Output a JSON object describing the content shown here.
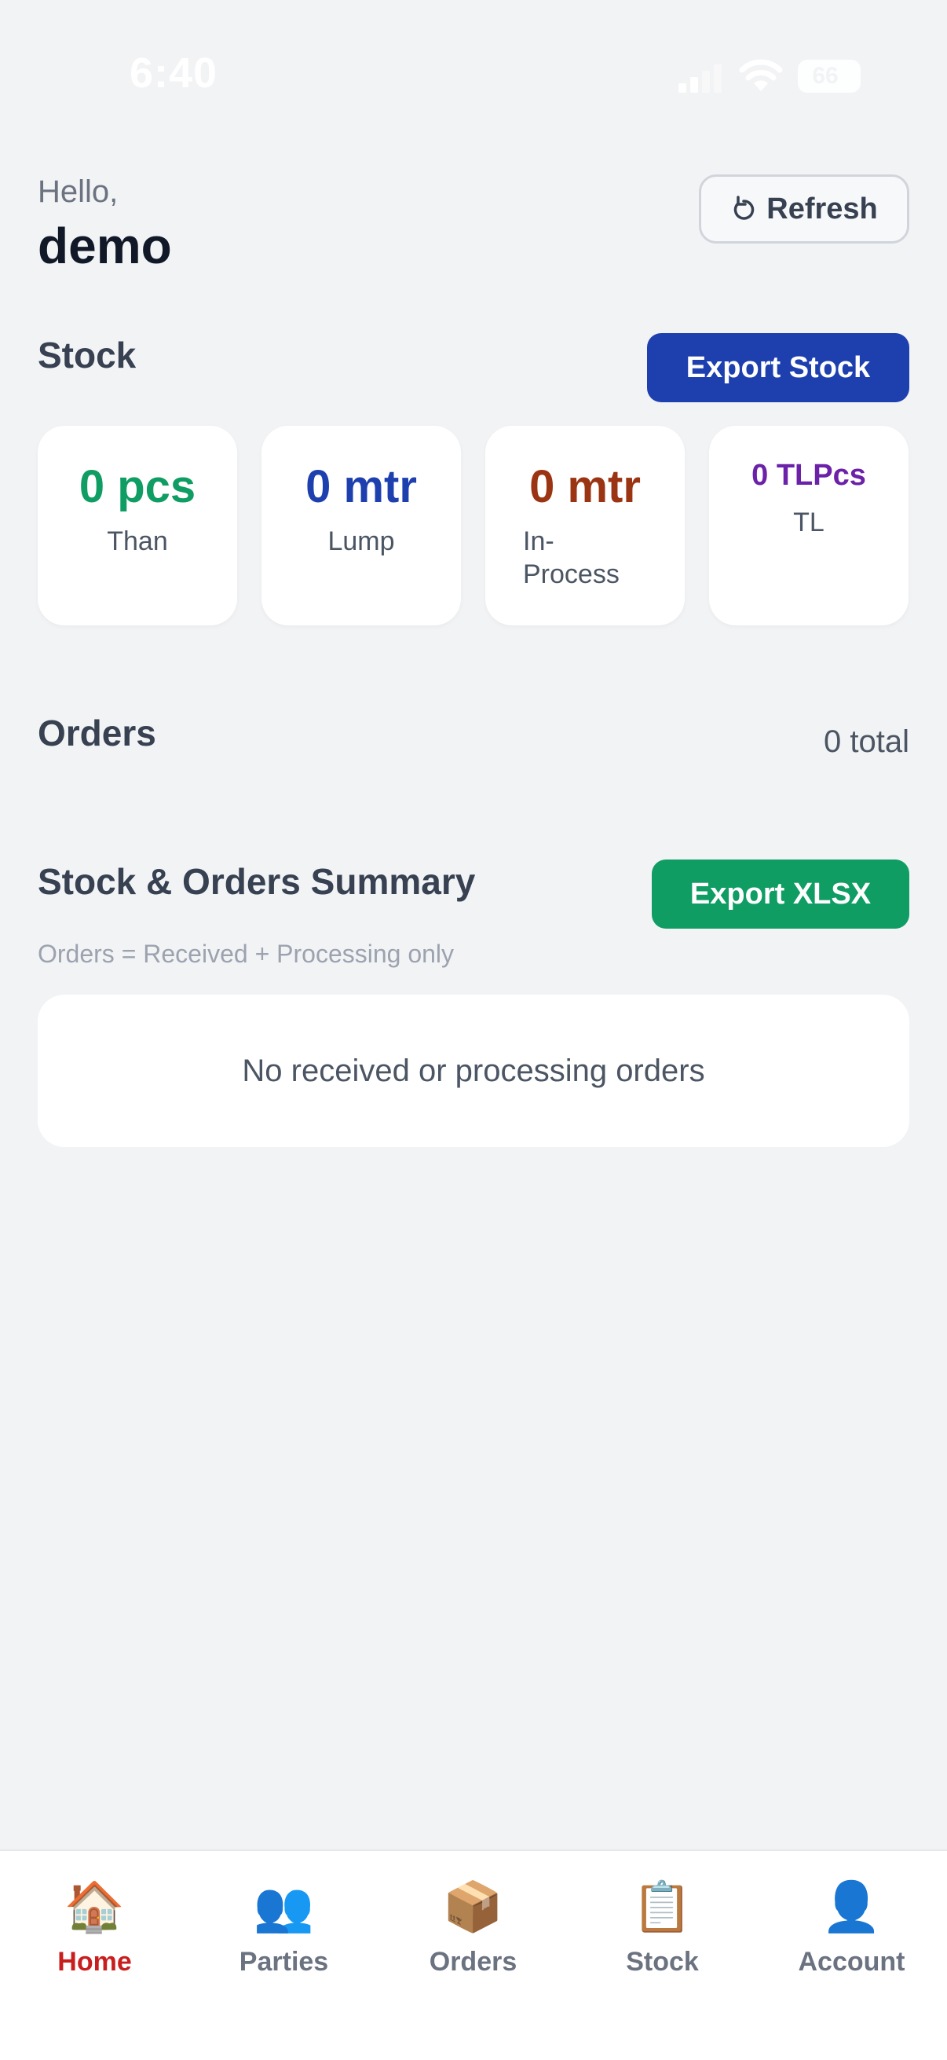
{
  "status_bar": {
    "time": "6:40",
    "battery": "66"
  },
  "header": {
    "greeting": "Hello,",
    "username": "demo",
    "refresh_label": "Refresh"
  },
  "stock": {
    "title": "Stock",
    "export_label": "Export Stock",
    "cards": [
      {
        "value": "0 pcs",
        "label": "Than",
        "color": "#0f9d64"
      },
      {
        "value": "0 mtr",
        "label": "Lump",
        "color": "#1e40af"
      },
      {
        "value": "0 mtr",
        "label": "In-Process",
        "color": "#9a3412"
      },
      {
        "value": "0 TLPcs",
        "label": "TL",
        "color": "#6b21a8"
      }
    ]
  },
  "orders": {
    "title": "Orders",
    "total": "0 total"
  },
  "summary": {
    "title": "Stock & Orders Summary",
    "export_label": "Export XLSX",
    "note": "Orders = Received + Processing only",
    "empty_message": "No received or processing orders"
  },
  "tabs": [
    {
      "label": "Home",
      "icon": "home-icon",
      "active": true
    },
    {
      "label": "Parties",
      "icon": "people-icon",
      "active": false
    },
    {
      "label": "Orders",
      "icon": "package-icon",
      "active": false
    },
    {
      "label": "Stock",
      "icon": "clipboard-icon",
      "active": false
    },
    {
      "label": "Account",
      "icon": "person-icon",
      "active": false
    }
  ]
}
